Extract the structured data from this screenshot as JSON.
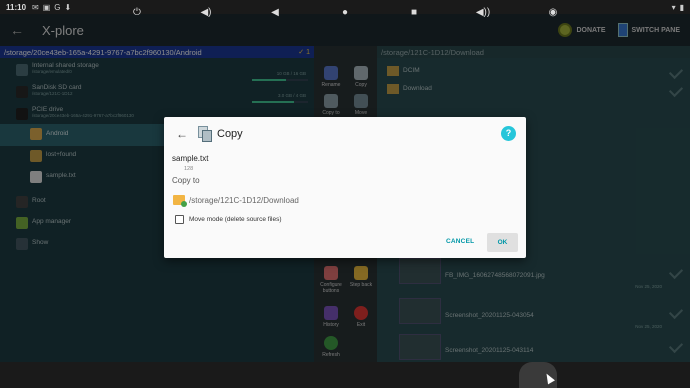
{
  "status_bar": {
    "time": "11:10",
    "icons": [
      "mail",
      "notification",
      "google",
      "download"
    ],
    "right_icons": [
      "wifi",
      "battery"
    ]
  },
  "app_bar": {
    "title": "X-plore",
    "donate_label": "DONATE",
    "switch_pane_label": "SWITCH PANE"
  },
  "left_pane": {
    "path": "/storage/20ce43eb-165a-4291-9767-a7bc2f960130/Android",
    "selected_count": "1",
    "items": [
      {
        "name": "Internal shared storage",
        "sub": "/storage/emulated/0",
        "meta": "10 GB / 16 GB"
      },
      {
        "name": "SanDisk SD card",
        "sub": "/storage/121C-1D12",
        "meta": "3.0 GB / 4 GB"
      },
      {
        "name": "PCIE drive",
        "sub": "/storage/20ce43eb-165a-4291-9767-a7bc2f960130",
        "meta": ""
      },
      {
        "name": "Android",
        "sub": "",
        "meta": ""
      },
      {
        "name": "lost+found",
        "sub": "",
        "meta": ""
      },
      {
        "name": "sample.txt",
        "sub": "",
        "meta": ""
      },
      {
        "name": "Root",
        "sub": "",
        "meta": ""
      },
      {
        "name": "App manager",
        "sub": "",
        "meta": ""
      },
      {
        "name": "Show",
        "sub": "",
        "meta": ""
      }
    ],
    "storage_fill": [
      0.6,
      0.75
    ]
  },
  "toolbar": {
    "buttons": [
      "Rename",
      "Copy",
      "Copy to",
      "Move",
      "Configure buttons",
      "Step back",
      "History",
      "Exit",
      "Refresh"
    ]
  },
  "right_pane": {
    "path": "/storage/121C-1D12/Download",
    "items": [
      {
        "name": "DCIM",
        "date": ""
      },
      {
        "name": "Download",
        "date": ""
      },
      {
        "name": "FB_IMG_16062748568072091.jpg",
        "date": "Nov 25, 2020"
      },
      {
        "name": "Screenshot_20201125-043054",
        "date": "Nov 25, 2020"
      },
      {
        "name": "Screenshot_20201125-043114",
        "date": "Nov 25, 2020"
      }
    ]
  },
  "dialog": {
    "title": "Copy",
    "help": "?",
    "file_name": "sample.txt",
    "file_size": "128",
    "copy_to_label": "Copy to",
    "destination": "/storage/121C-1D12/Download",
    "move_mode_label": "Move mode (delete source files)",
    "move_mode_checked": false,
    "cancel_label": "CANCEL",
    "ok_label": "OK",
    "accent": "#0097a7"
  },
  "nav_bar": {
    "icons": [
      "power-icon",
      "volume-down-icon",
      "back-icon",
      "home-icon",
      "recents-icon",
      "volume-up-icon",
      "screenshot-icon"
    ]
  }
}
